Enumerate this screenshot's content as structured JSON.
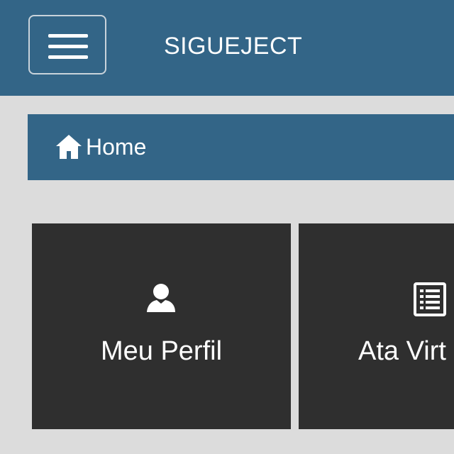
{
  "header": {
    "title": "SIGUEJECT",
    "menu_icon": "hamburger-menu-icon"
  },
  "breadcrumb": {
    "home_label": "Home",
    "home_icon": "home-icon"
  },
  "tiles": [
    {
      "label": "Meu Perfil",
      "icon": "user-icon"
    },
    {
      "label": "Ata Virt",
      "icon": "document-list-icon"
    }
  ],
  "colors": {
    "header_background": "#336587",
    "page_background": "#dcdcdc",
    "tile_background": "#2f2f2f",
    "text_light": "#ffffff"
  }
}
